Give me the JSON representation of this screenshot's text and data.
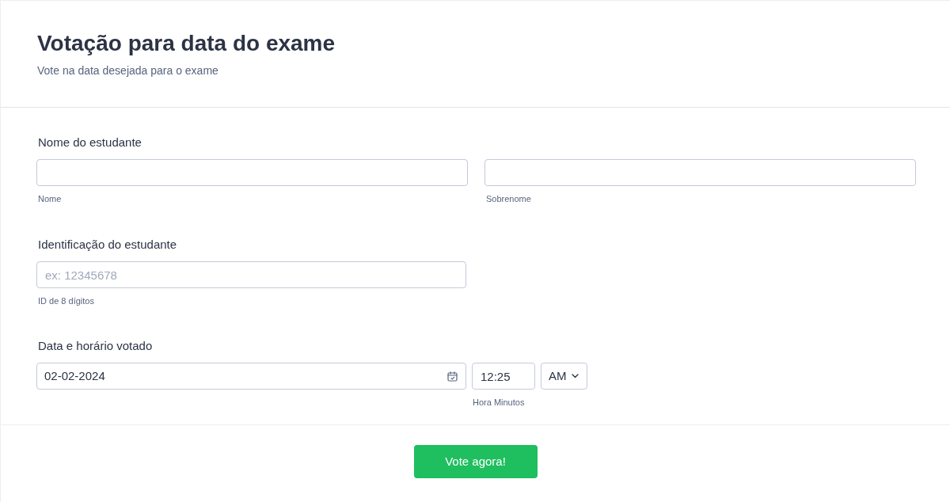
{
  "header": {
    "title": "Votação para data do exame",
    "subtitle": "Vote na data desejada para o exame"
  },
  "fields": [
    {
      "kind": "fullname",
      "label": "Nome do estudante",
      "inputs": [
        {
          "sublabel": "Nome"
        },
        {
          "sublabel": "Sobrenome"
        }
      ]
    },
    {
      "kind": "text",
      "label": "Identificação do estudante",
      "placeholder": "ex: 12345678",
      "sublabel": "ID de 8 dígitos"
    },
    {
      "kind": "datetime",
      "label": "Data e horário votado",
      "date": "02-02-2024",
      "time": "12:25",
      "period": "AM",
      "sublabel": "Hora Minutos"
    }
  ],
  "submit_button": "Vote agora!"
}
